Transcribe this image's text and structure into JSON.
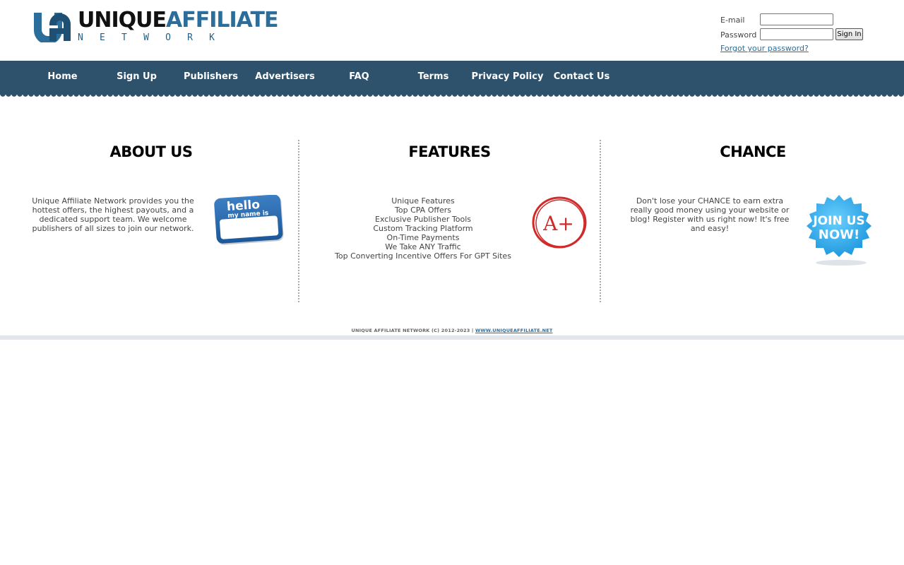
{
  "header": {
    "logo": {
      "mark": "UA",
      "word_black": "UNIQUE",
      "word_blue": "AFFILIATE",
      "sub": "NETWORK"
    },
    "login": {
      "email_label": "E-mail",
      "email_value": "",
      "password_label": "Password",
      "password_value": "",
      "signin_label": "Sign In",
      "forgot_label": "Forgot your password?"
    }
  },
  "nav": {
    "items": [
      {
        "label": "Home"
      },
      {
        "label": "Sign Up"
      },
      {
        "label": "Publishers"
      },
      {
        "label": "Advertisers"
      },
      {
        "label": "FAQ"
      },
      {
        "label": "Terms"
      },
      {
        "label": "Privacy Policy"
      },
      {
        "label": "Contact Us"
      }
    ]
  },
  "columns": {
    "about": {
      "title": "ABOUT US",
      "text": "Unique Affiliate Network provides you the hottest offers, the highest payouts, and a dedicated support team. We welcome publishers of all sizes to join our network.",
      "badge": {
        "line1": "hello",
        "line2": "my name is"
      }
    },
    "features": {
      "title": "FEATURES",
      "items": [
        "Unique Features",
        "Top CPA Offers",
        "Exclusive Publisher Tools",
        "Custom Tracking Platform",
        "On-Time Payments",
        "We Take ANY Traffic",
        "Top Converting Incentive Offers For GPT Sites"
      ],
      "badge": {
        "grade": "A+"
      }
    },
    "chance": {
      "title": "CHANCE",
      "text": "Don't lose your CHANCE to earn extra really good money using your website or blog! Register with us right now! It's free and easy!",
      "badge": {
        "line1": "JOIN US",
        "line2": "NOW!"
      }
    }
  },
  "footer": {
    "copyright": "UNIQUE AFFILIATE NETWORK (C) 2012-2023 |",
    "link": "WWW.UNIQUEAFFILIATE.NET"
  },
  "colors": {
    "nav_bg": "#2e526c",
    "brand_blue": "#2b6d9b",
    "link": "#2b6d9b",
    "footer_bar": "#e2e6ea"
  }
}
